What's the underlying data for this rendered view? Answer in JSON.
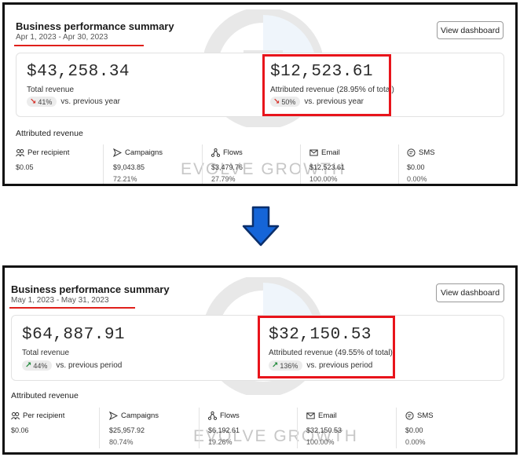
{
  "watermark_text": "EVOLVE GROWTH",
  "colors": {
    "highlight": "#e8141b",
    "underline": "#e0201b",
    "arrow_blue": "#1565d8",
    "trend_down": "#d6322a",
    "trend_up": "#1f8a3a"
  },
  "panels": [
    {
      "title": "Business performance summary",
      "date_range": "Apr 1, 2023 - Apr 30, 2023",
      "button_label": "View dashboard",
      "total_revenue": {
        "value": "$43,258.34",
        "label": "Total revenue",
        "delta_icon": "trend-down-icon",
        "delta_pct": "41%",
        "delta_text": "vs. previous year"
      },
      "attributed_revenue": {
        "value": "$12,523.61",
        "label": "Attributed revenue (28.95% of total)",
        "delta_icon": "trend-down-icon",
        "delta_pct": "50%",
        "delta_text": "vs. previous year"
      },
      "attributed_section_title": "Attributed revenue",
      "columns": [
        {
          "icon": "people-icon",
          "label": "Per recipient",
          "value": "$0.05",
          "pct": ""
        },
        {
          "icon": "send-icon",
          "label": "Campaigns",
          "value": "$9,043.85",
          "pct": "72.21%"
        },
        {
          "icon": "flows-icon",
          "label": "Flows",
          "value": "$3,479.76",
          "pct": "27.79%"
        },
        {
          "icon": "email-icon",
          "label": "Email",
          "value": "$12,523.61",
          "pct": "100.00%"
        },
        {
          "icon": "sms-icon",
          "label": "SMS",
          "value": "$0.00",
          "pct": "0.00%"
        }
      ]
    },
    {
      "title": "Business performance summary",
      "date_range": "May 1, 2023 - May 31, 2023",
      "button_label": "View dashboard",
      "total_revenue": {
        "value": "$64,887.91",
        "label": "Total revenue",
        "delta_icon": "trend-up-icon",
        "delta_pct": "44%",
        "delta_text": "vs. previous period"
      },
      "attributed_revenue": {
        "value": "$32,150.53",
        "label": "Attributed revenue (49.55% of total)",
        "delta_icon": "trend-up-icon",
        "delta_pct": "136%",
        "delta_text": "vs. previous period"
      },
      "attributed_section_title": "Attributed revenue",
      "columns": [
        {
          "icon": "people-icon",
          "label": "Per recipient",
          "value": "$0.06",
          "pct": ""
        },
        {
          "icon": "send-icon",
          "label": "Campaigns",
          "value": "$25,957.92",
          "pct": "80.74%"
        },
        {
          "icon": "flows-icon",
          "label": "Flows",
          "value": "$6,192.61",
          "pct": "19.26%"
        },
        {
          "icon": "email-icon",
          "label": "Email",
          "value": "$32,150.53",
          "pct": "100.00%"
        },
        {
          "icon": "sms-icon",
          "label": "SMS",
          "value": "$0.00",
          "pct": "0.00%"
        }
      ]
    }
  ]
}
